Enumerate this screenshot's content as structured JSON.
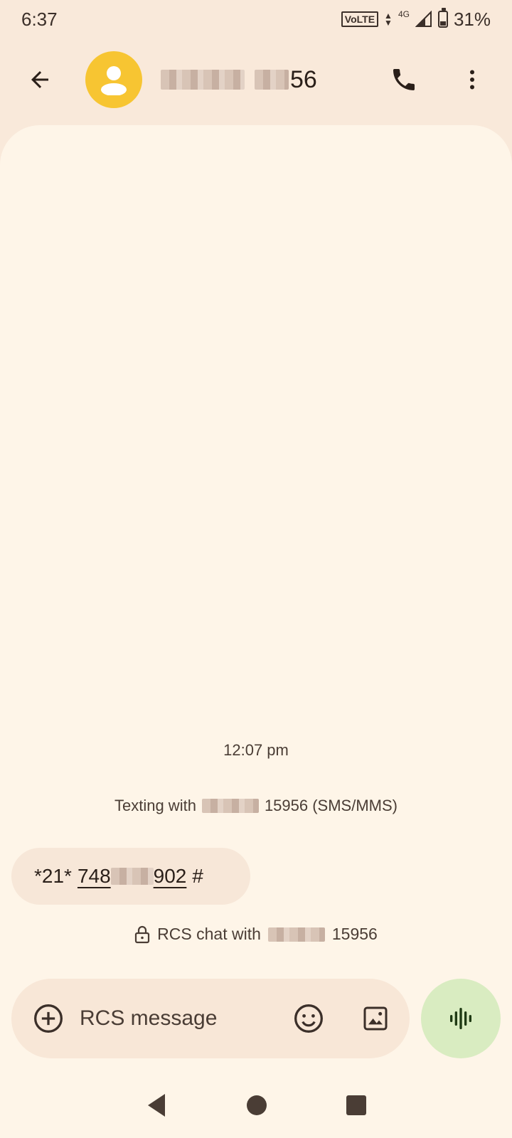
{
  "status_bar": {
    "time": "6:37",
    "volte": "VoLTE",
    "network": "4G",
    "battery": "31%"
  },
  "header": {
    "contact_name_suffix": "56"
  },
  "conversation": {
    "timestamp": "12:07 pm",
    "texting_with_prefix": "Texting with",
    "texting_with_suffix": "15956 (SMS/MMS)",
    "message": {
      "prefix": "*21*",
      "number_start": "748",
      "number_end": "902",
      "suffix": "#"
    },
    "rcs_chat_prefix": "RCS chat with",
    "rcs_chat_suffix": "15956"
  },
  "compose": {
    "placeholder": "RCS message"
  },
  "colors": {
    "avatar": "#f7c532",
    "voice_button": "#d9ecc1",
    "background": "#f9e9da",
    "chat_surface": "#fef5e8"
  }
}
